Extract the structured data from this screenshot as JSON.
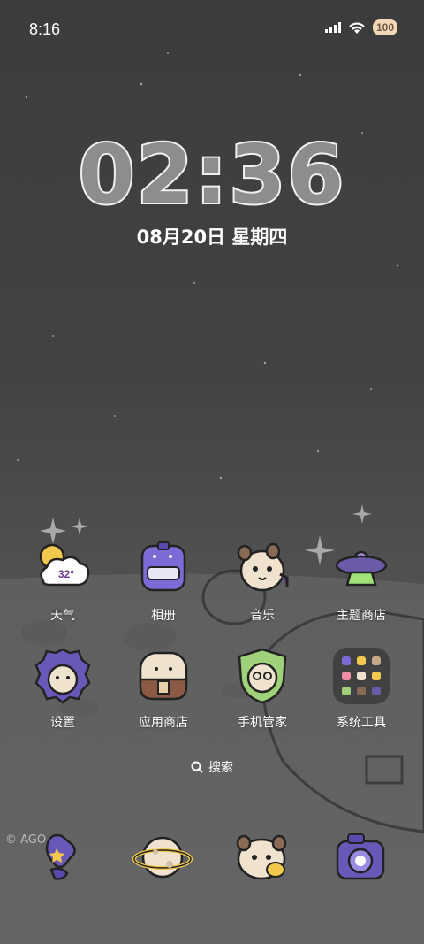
{
  "status_bar": {
    "time": "8:16",
    "battery": "100"
  },
  "clock": {
    "time": "02:36",
    "date": "08月20日 星期四"
  },
  "apps_row1": [
    {
      "label": "天气",
      "icon": "weather-icon",
      "temp": "32°"
    },
    {
      "label": "相册",
      "icon": "gallery-icon"
    },
    {
      "label": "音乐",
      "icon": "music-icon"
    },
    {
      "label": "主题商店",
      "icon": "theme-store-icon"
    }
  ],
  "apps_row2": [
    {
      "label": "设置",
      "icon": "settings-icon"
    },
    {
      "label": "应用商店",
      "icon": "app-store-icon"
    },
    {
      "label": "手机管家",
      "icon": "phone-manager-icon"
    },
    {
      "label": "系统工具",
      "icon": "system-tools-folder-icon"
    }
  ],
  "search": {
    "label": "搜索"
  },
  "watermark": "© AGO",
  "dock": [
    {
      "icon": "phone-icon"
    },
    {
      "icon": "browser-planet-icon"
    },
    {
      "icon": "messages-icon"
    },
    {
      "icon": "camera-icon"
    }
  ]
}
